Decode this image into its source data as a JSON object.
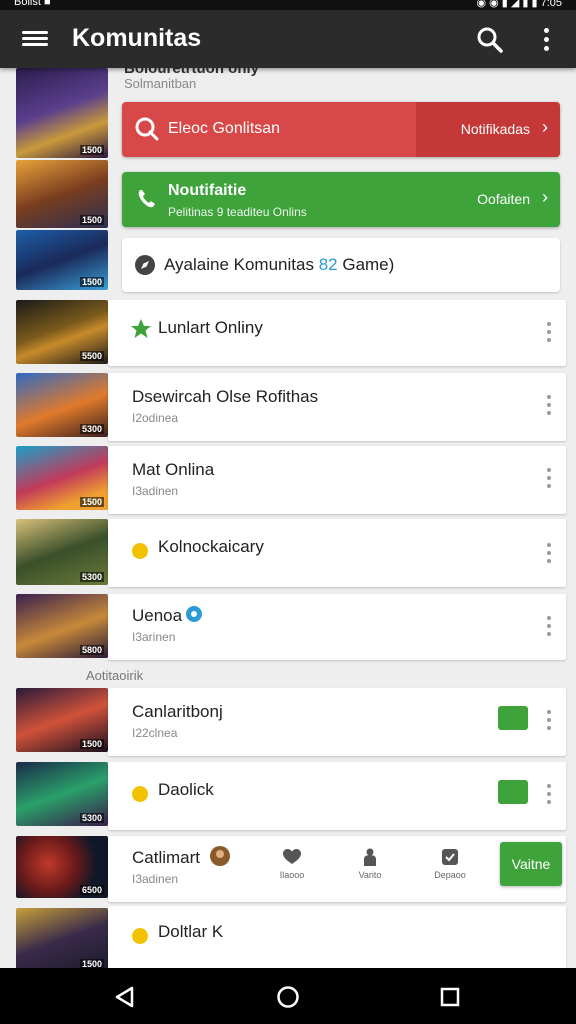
{
  "status": {
    "left": "Bolist ■",
    "right": "◉ ◉ ▮ ◢ ▮ ▮ 7:05"
  },
  "appbar": {
    "title": "Komunitas"
  },
  "header": {
    "clipped_title": "Bolouretrtuon only",
    "subtitle": "Solmanitban"
  },
  "banners": {
    "red": {
      "label": "Eleoc Gonlitsan",
      "action": "Notifikadas",
      "color": "#d94848"
    },
    "green": {
      "title": "Noutifaitie",
      "subtitle": "Pelitinas 9 teaditeu Onlins",
      "action": "Oofaiten",
      "color": "#3ea33a"
    }
  },
  "available": {
    "before": "Ayalaine Komunitas",
    "count": "82",
    "after": "Game)"
  },
  "thumb_tags": [
    "1500",
    "1500",
    "1500",
    "5500",
    "5300",
    "1500",
    "5300",
    "5800",
    "1500",
    "5300",
    "6500",
    "1500"
  ],
  "cards": [
    {
      "name": "Lunlart Onliny",
      "sub": "",
      "badge": "green-star"
    },
    {
      "name": "Dsewircah Olse Rofithas",
      "sub": "I2odinea",
      "badge": ""
    },
    {
      "name": "Mat Onlina",
      "sub": "I3adinen",
      "badge": ""
    },
    {
      "name": "Kolnockaicary",
      "sub": "",
      "badge": "yellow-dot"
    },
    {
      "name": "Uenoa",
      "sub": "I3arinen",
      "badge": "blue-badge"
    },
    {
      "name": "Canlaritbonj",
      "sub": "I22clnea",
      "badge": "green-chip"
    },
    {
      "name": "Daolick",
      "sub": "",
      "badge": "yellow-dot-green-chip"
    },
    {
      "name": "Catlimart",
      "sub": "I3adinen",
      "badge": "avatar"
    },
    {
      "name": "Doltlar K",
      "sub": "",
      "badge": "yellow-dot"
    }
  ],
  "section_label": "Aotitaoirik",
  "mini_nav": [
    {
      "label": "Ilaooo",
      "icon": "heart-chat-icon"
    },
    {
      "label": "Varito",
      "icon": "person-icon"
    },
    {
      "label": "Depaoo",
      "icon": "badge-icon"
    }
  ],
  "join_button": "Vaitne",
  "colors": {
    "accent_green": "#3ea33a",
    "accent_red": "#d94848",
    "appbar": "#2b2b2b"
  }
}
